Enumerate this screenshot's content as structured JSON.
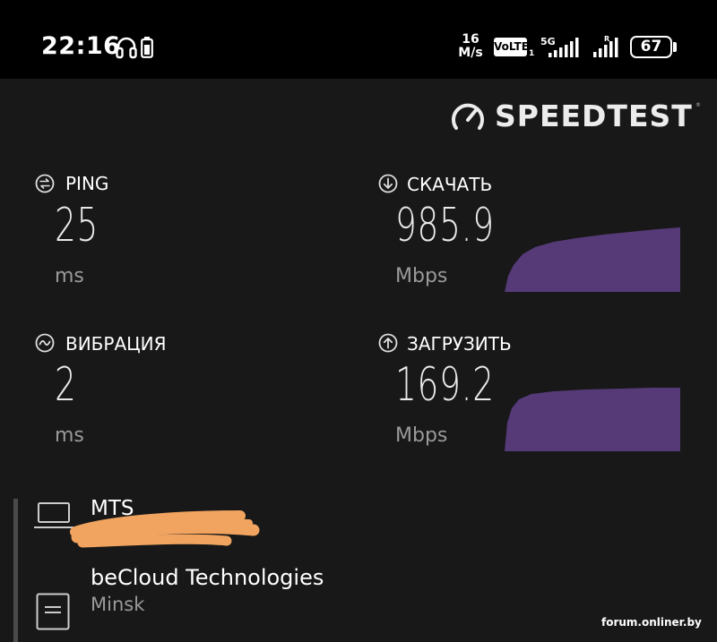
{
  "status_bar": {
    "time": "22:16",
    "net_speed_value": "16",
    "net_speed_unit": "M/s",
    "volte": "VoLTE",
    "volte_sub": "1",
    "network_type": "5G",
    "roaming_mark": "R",
    "battery_level": "67",
    "icons": [
      "headphones-icon",
      "phone-battery-icon",
      "signal-icon",
      "battery-icon"
    ]
  },
  "brand": {
    "name": "SPEEDTEST",
    "reg": "®",
    "icon": "speedometer-icon"
  },
  "metrics": {
    "ping": {
      "label": "PING",
      "value": "25",
      "unit": "ms",
      "icon": "ping-icon"
    },
    "download": {
      "label": "СКАЧАТЬ",
      "value": "985.9",
      "unit": "Mbps",
      "icon": "download-arrow-icon"
    },
    "jitter": {
      "label": "ВИБРАЦИЯ",
      "value": "2",
      "unit": "ms",
      "icon": "jitter-wave-icon"
    },
    "upload": {
      "label": "ЗАГРУЗИТЬ",
      "value": "169.2",
      "unit": "Mbps",
      "icon": "upload-arrow-icon"
    }
  },
  "colors": {
    "graph": "#563a78",
    "background": "#181818",
    "status_bar": "#000000"
  },
  "provider": {
    "name": "MTS",
    "icon": "laptop-icon"
  },
  "server": {
    "name": "beCloud Technologies",
    "city": "Minsk",
    "icon": "server-icon"
  },
  "watermark": "forum.onliner.by"
}
